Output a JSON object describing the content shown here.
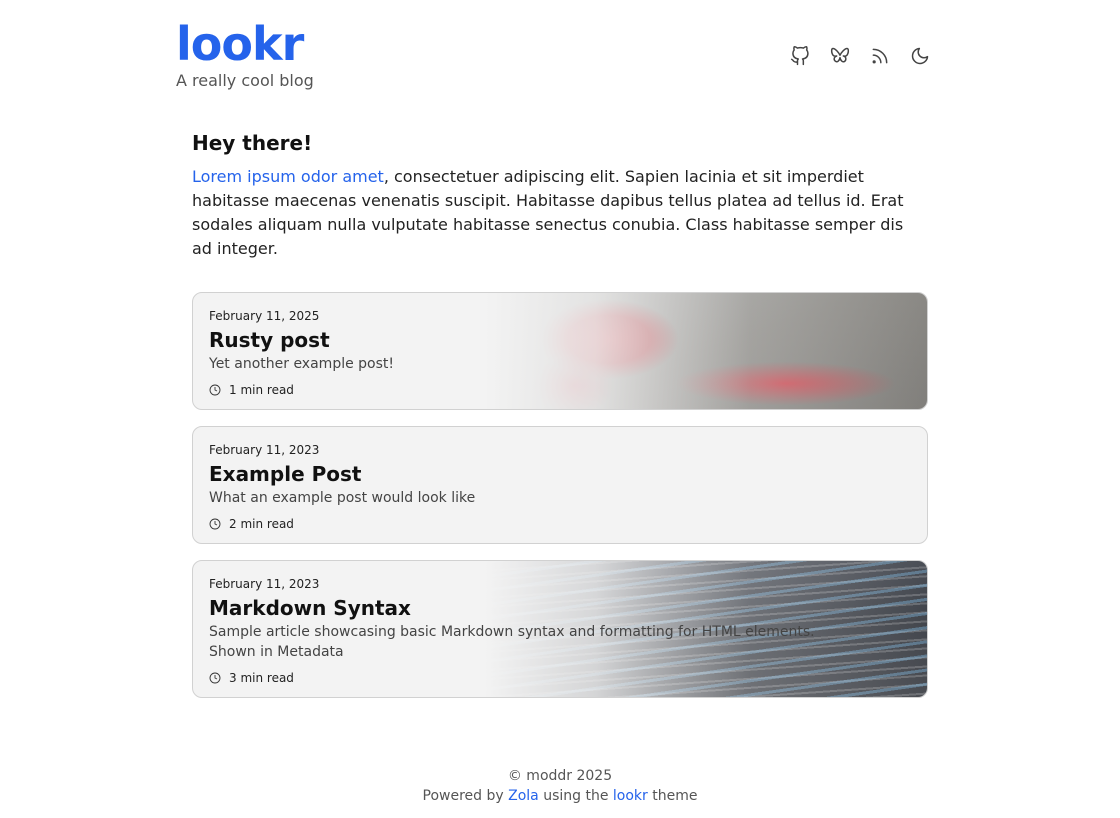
{
  "header": {
    "site_title": "lookr",
    "subtitle": "A really cool blog",
    "icons": [
      "github-icon",
      "bluesky-icon",
      "rss-icon",
      "moon-icon"
    ]
  },
  "intro": {
    "title": "Hey there!",
    "link_text": "Lorem ipsum odor amet",
    "body": ", consectetuer adipiscing elit. Sapien lacinia et sit imperdiet habitasse maecenas venenatis suscipit. Habitasse dapibus tellus platea ad tellus id. Erat sodales aliquam nulla vulputate habitasse senectus conubia. Class habitasse semper dis ad integer."
  },
  "posts": [
    {
      "date": "February 11, 2025",
      "title": "Rusty post",
      "description": "Yet another example post!",
      "read_time": "1 min read"
    },
    {
      "date": "February 11, 2023",
      "title": "Example Post",
      "description": "What an example post would look like",
      "read_time": "2 min read"
    },
    {
      "date": "February 11, 2023",
      "title": "Markdown Syntax",
      "description": "Sample article showcasing basic Markdown syntax and formatting for HTML elements.",
      "description_line2": "Shown in Metadata",
      "read_time": "3 min read"
    }
  ],
  "footer": {
    "copyright": "© moddr 2025",
    "powered_prefix": "Powered by",
    "zola": "Zola",
    "using_the": "using the",
    "lookr": "lookr",
    "theme": "theme"
  },
  "colors": {
    "accent": "#2563eb",
    "card_bg": "#f3f3f3",
    "card_border": "#d1d1d1"
  }
}
